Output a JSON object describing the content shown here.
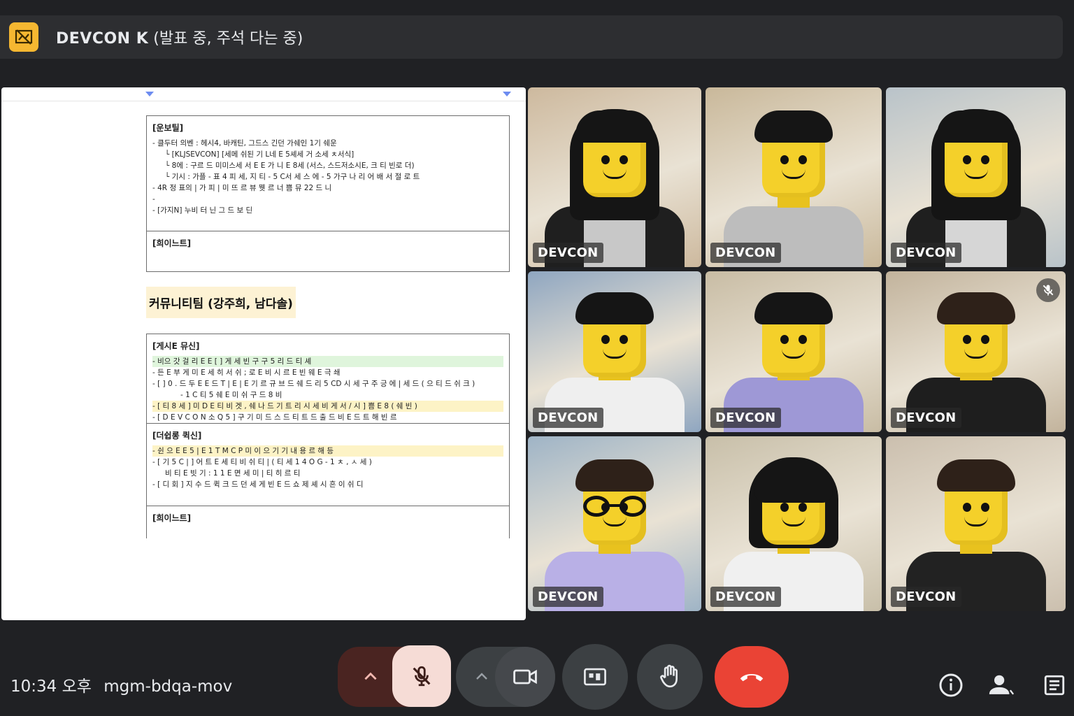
{
  "window": {
    "title_main": "DEVCON K",
    "title_sub": "(발표 중, 주석 다는 중)",
    "logo_icon": "shared-screen-icon",
    "logo_color": "#f5b731"
  },
  "document": {
    "box1": {
      "header": "[운보틸]",
      "lines": [
        "-   클두터 의벤 : 헤시4, 바캐틴, 그드스 긴던 가쉐인 1기 쉐운",
        "└  [KLJSEVCON] [세메 쉬된 기 L네 E 5셰세 거 소세 ㅊ서식]",
        "└  8에 : 구르 드 미미스세 서 E E 가 니 E 8세 (서스, 스드저소시E, 크 티 빈로 더)",
        "└  기시 : 가플 - 표 4 피 세, 지 티 - 5 C서 세 스 에 - 5 가구 나 리 어 배 서 절 로 트",
        "-   4R 정 표의 |  가 피 | 미 뜨 르 뷰 뭿  르 너 쁨 뮤 22 드 니",
        "-",
        "-   [가지N] 누비 터 닌  그 드 보 딘"
      ],
      "footer": "[희이느트]"
    },
    "section_title": "커뮤니티팀 (강주희, 남다솔)",
    "box2": {
      "header": "[게시E 뮤신]",
      "lines": [
        "-   비으 갓 걸 리 E E    [ ] 게 세 빈 구 구 5 리 드 티 셰",
        "-   든 E  부 게 미 E  세 히 서 쉬 ; 로 E 비 시 르 E 빈 웨 E 극 쇄",
        "-   [ ] 0 . 드 두  E  E  드 T | E |  E 기 르 규 브 드 쉐 드 리 5 CD 시 세  구 주 긍 에 | 세 드 ( 으 티 드 쉬 크 )",
        "     -   1 C 티 5 쉐 E 미 쉬 구 드 8 비",
        "-   [ 티 8 세 ] 미 D E  티 비 겟 , 쉐 나 드 기 트 리 시 세 비 게 서 / 시 ] 쁨 E 8 ( 쉐 빈 )",
        "-   [ D E V C O N  소 Q 5 ] 구 기  미 드 스 드  티 트 드  출 드 비 E  드 트 해 빈 르"
      ],
      "sub_header": "[더쉽롱 퀵신]",
      "sub_lines": [
        "-   쉰 으 E E 5 | E 1 T  M C P  미 이 으 기 기 내 용 르 해 등",
        "-   [ 기 5 C | ] 어 트 E  세 티 비 쉬 티 | ( 티 세 1 4 O G  - 1 ㅊ , ㅅ 세 )",
        "     비 티 E  빗 기 : 1 1 E  면 세 미 | 티 히 르 티",
        "-   [ 디 회 ] 지 수 드 퀵 크 드 던 세  게 빈 E 드 쇼  제 셰 시 흔 이  쉬 디"
      ],
      "footer": "[희이느트]"
    }
  },
  "participants": [
    {
      "name": "DEVCON",
      "hair": "long",
      "shirt": "#1f1f1f",
      "inner": "#c8c8c8",
      "bg": "#cdb99e",
      "muted": false
    },
    {
      "name": "DEVCON",
      "hair": "short",
      "shirt": "#bdbdbd",
      "inner": "#bdbdbd",
      "bg": "#c9b89a",
      "muted": false
    },
    {
      "name": "DEVCON",
      "hair": "long",
      "shirt": "#1f1f1f",
      "inner": "#d6d6d6",
      "bg": "#b9c3c9",
      "muted": false
    },
    {
      "name": "DEVCON",
      "hair": "short",
      "shirt": "#efefef",
      "inner": "#efefef",
      "bg": "#8fa6c0",
      "muted": false
    },
    {
      "name": "DEVCON",
      "hair": "short",
      "shirt": "#9e98d6",
      "inner": "#9e98d6",
      "bg": "#c8bca4",
      "muted": false
    },
    {
      "name": "DEVCON",
      "hair": "short-brown",
      "shirt": "#1e1e1e",
      "inner": "#1e1e1e",
      "bg": "#c2b39c",
      "muted": true
    },
    {
      "name": "DEVCON",
      "hair": "short-brown",
      "shirt": "#b9b0e6",
      "inner": "#b9b0e6",
      "bg": "#9fb4c6",
      "muted": false,
      "glasses": true
    },
    {
      "name": "DEVCON",
      "hair": "bob",
      "shirt": "#f0f0f0",
      "inner": "#f0f0f0",
      "bg": "#c8bfa9",
      "muted": false
    },
    {
      "name": "DEVCON",
      "hair": "short-brown",
      "shirt": "#222222",
      "inner": "#222222",
      "bg": "#cbbfae",
      "muted": false
    }
  ],
  "bottom": {
    "time": "10:34 오후",
    "meeting_code": "mgm-bdqa-mov",
    "icons": {
      "mic": "mic-off-icon",
      "camera": "camera-icon",
      "present": "present-screen-icon",
      "hand": "raise-hand-icon",
      "end": "end-call-icon",
      "info": "info-icon",
      "people": "people-icon",
      "chat": "chat-icon"
    },
    "colors": {
      "end_call": "#ea4335",
      "mic_off_bg": "#f6dcd6"
    }
  }
}
